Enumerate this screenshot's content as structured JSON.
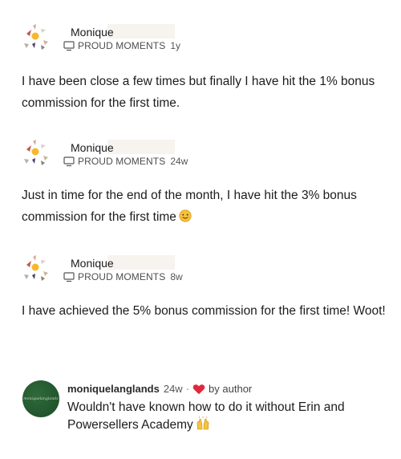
{
  "posts": [
    {
      "author": "Monique",
      "topic": "PROUD MOMENTS",
      "time": "1y",
      "body": "I have been close a few times but finally I have hit the 1% bonus commission for the first time."
    },
    {
      "author": "Monique",
      "topic": "PROUD MOMENTS",
      "time": "24w",
      "body": "Just in time for the end of the month, I have hit the 3% bonus commission for the first time"
    },
    {
      "author": "Monique",
      "topic": "PROUD MOMENTS",
      "time": "8w",
      "body": "I have achieved the 5% bonus commission for the first time! Woot!"
    }
  ],
  "comment": {
    "user": "moniquelanglands",
    "time": "24w",
    "separator": "·",
    "badge": "by author",
    "text": "Wouldn't have known how to do it without Erin and Powersellers Academy",
    "avatar_text": "moniquelanglands"
  },
  "icons": {
    "topic": "monitor-icon",
    "reaction": "heart-icon",
    "emoji_post2": "smiling-face-icon",
    "emoji_comment": "raising-hands-icon"
  },
  "colors": {
    "heart": "#e0283c",
    "avatar_green": "#245a30"
  }
}
